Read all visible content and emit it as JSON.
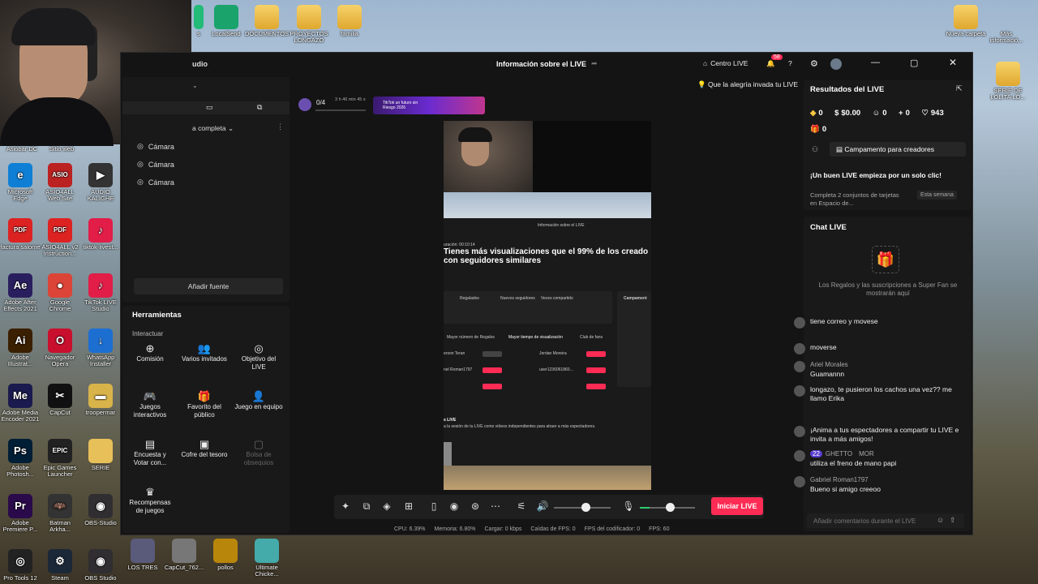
{
  "desktop_icons": {
    "top": [
      {
        "label": "s",
        "kind": "partial"
      },
      {
        "label": "LocalSend",
        "kind": "app",
        "color": "#1aa36b"
      },
      {
        "label": "DOCUMENTOS",
        "kind": "folder"
      },
      {
        "label": "PROYECTOS LONGAZO",
        "kind": "folder"
      },
      {
        "label": "familia",
        "kind": "folder"
      },
      {
        "label": "Nueva carpeta",
        "kind": "folder"
      },
      {
        "label": "Más informació...",
        "kind": "app"
      }
    ],
    "left": [
      {
        "label": "Asiobar DC",
        "kind": "partial"
      },
      {
        "label": "Sitio web",
        "kind": "partial"
      },
      {
        "label": "Microsoft Edge",
        "glyph": "e",
        "color": "#0f7fd6"
      },
      {
        "label": "ASIO4ALL Web Site",
        "glyph": "ASIO",
        "color": "#b22"
      },
      {
        "label": "AUDIO KALIGHE",
        "glyph": "▶",
        "color": "#333"
      },
      {
        "label": "factura salome",
        "glyph": "PDF",
        "color": "#d22"
      },
      {
        "label": "ASIO4ALL v2 Instruction...",
        "glyph": "PDF",
        "color": "#d22"
      },
      {
        "label": "tiktok-livest...",
        "glyph": "♪",
        "color": "#e11d48"
      },
      {
        "label": "Adobe After Effects 2021",
        "glyph": "Ae",
        "color": "#2a1f5e"
      },
      {
        "label": "Google Chrome",
        "glyph": "●",
        "color": "#db4437"
      },
      {
        "label": "TikTok LIVE Studio",
        "glyph": "♪",
        "color": "#e11d48"
      },
      {
        "label": "Adobe Illustrat...",
        "glyph": "Ai",
        "color": "#3a1f00"
      },
      {
        "label": "Navegador Opera",
        "glyph": "O",
        "color": "#c8102e"
      },
      {
        "label": "WhatsApp Installer",
        "glyph": "↓",
        "color": "#1c6fd1"
      },
      {
        "label": "Adobe Media Encoder 2021",
        "glyph": "Me",
        "color": "#1b1a4e"
      },
      {
        "label": "CapCut",
        "glyph": "✂",
        "color": "#111"
      },
      {
        "label": "troopermar",
        "glyph": "▬",
        "color": "#d8b34a"
      },
      {
        "label": "Adobe Photosh...",
        "glyph": "Ps",
        "color": "#001e36"
      },
      {
        "label": "Epic Games Launcher",
        "glyph": "EPIC",
        "color": "#222"
      },
      {
        "label": "SERIE",
        "glyph": "",
        "color": "#e8c05a"
      },
      {
        "label": "Adobe Premiere P...",
        "glyph": "Pr",
        "color": "#2a0a4a"
      },
      {
        "label": "Batman Arkha...",
        "glyph": "🦇",
        "color": "#333"
      },
      {
        "label": "OBS-Studio",
        "glyph": "◉",
        "color": "#302e31"
      },
      {
        "label": "Pro Tools 12",
        "glyph": "◎",
        "color": "#222"
      },
      {
        "label": "Steam",
        "glyph": "⚙",
        "color": "#1b2838"
      },
      {
        "label": "OBS Studio",
        "glyph": "◉",
        "color": "#302e31"
      }
    ],
    "bottom": [
      {
        "label": "LOS TRES",
        "color": "#5a5a7a"
      },
      {
        "label": "CapCut_762...",
        "color": "#777"
      },
      {
        "label": "pollos",
        "color": "#b8860b"
      },
      {
        "label": "Ultimate Chicke...",
        "color": "#4aa"
      }
    ],
    "right": [
      {
        "label": "SERIE DE LOLITA LO...",
        "kind": "folder"
      }
    ]
  },
  "window": {
    "app_title_partial": "udio",
    "center_title": "Información sobre el LIVE",
    "centro_live": "Centro LIVE",
    "notif_count": "58",
    "scene_name": "a completa",
    "sources": [
      "Cámara",
      "Cámara",
      "Cámara"
    ],
    "add_source": "Añadir fuente",
    "tools_title": "Herramientas",
    "interact_label": "Interactuar",
    "tools": [
      {
        "label": "Comisión",
        "icon": "coin-icon",
        "glyph": "⊕",
        "enabled": true
      },
      {
        "label": "Varios invitados",
        "icon": "guests-icon",
        "glyph": "👥",
        "enabled": true
      },
      {
        "label": "Objetivo del LIVE",
        "icon": "target-icon",
        "glyph": "◎",
        "enabled": true
      },
      {
        "label": "Juegos interactivos",
        "icon": "gamepad-icon",
        "glyph": "🎮",
        "enabled": true
      },
      {
        "label": "Favorito del público",
        "icon": "gift-icon",
        "glyph": "🎁",
        "enabled": true
      },
      {
        "label": "Juego en equipo",
        "icon": "team-icon",
        "glyph": "👤",
        "enabled": true
      },
      {
        "label": "Encuesta y Votar con...",
        "icon": "poll-icon",
        "glyph": "▤",
        "enabled": true
      },
      {
        "label": "Cofre del tesoro",
        "icon": "chest-icon",
        "glyph": "▣",
        "enabled": true
      },
      {
        "label": "Bolsa de obsequios",
        "icon": "bag-icon",
        "glyph": "▢",
        "enabled": false
      },
      {
        "label": "Recompensas de juegos",
        "icon": "reward-icon",
        "glyph": "♛",
        "enabled": true
      }
    ],
    "goal_progress": "0/4",
    "timer": "3 h 46 min 45 s",
    "banner_text": "TikTok un futuro sin Riesgo 2026",
    "right_hint": "Que la alegría invada tu LIVE",
    "preview": {
      "headline": "Tienes más visualizaciones que el 99% de los creado con seguidores similares",
      "mini_title": "Información sobre el LIVE",
      "tabs": [
        "Mayor número de Regalos",
        "Mayor tiempo de visualización",
        "Club de fans"
      ],
      "names": [
        "erson Teran",
        "nel Roman1797",
        "",
        "Jordan Moreira",
        "user1236061860..."
      ],
      "col_labels": [
        "Regalados",
        "Nuevos seguidores",
        "Veces compartido"
      ],
      "live_label": "s LIVE",
      "live_sub": "a la sesión de tu LIVE como vídeos independientes para atraer a más espectadores.",
      "campaign": "Campament",
      "duration": "uración: 00:10:14"
    },
    "results": {
      "title": "Resultados del LIVE",
      "diamonds": "0",
      "money": "$0.00",
      "viewers": "0",
      "new_followers": "0",
      "likes": "943",
      "gifts": "0"
    },
    "campaign_button": "Campamento para creadores",
    "promo_title": "¡Un buen LIVE empieza por un solo clic!",
    "promo_text": "Completa 2 conjuntos de tarjetas en Espacio de...",
    "promo_tag": "Esta semana",
    "chat": {
      "title": "Chat LIVE",
      "empty_text": "Los Regalos y las suscripciones a Super Fan se mostrarán aquí",
      "messages": [
        {
          "name": "",
          "text": "tiene correo y movese"
        },
        {
          "name": "",
          "text": "moverse"
        },
        {
          "name": "Ariel Morales",
          "text": "Guamannn"
        },
        {
          "name": "",
          "text": "longazo, te pusieron los cachos una vez?? me llamo Erika"
        },
        {
          "name": "",
          "text": "¡Anima a tus espectadores a compartir tu LIVE e invita a más amigos!"
        },
        {
          "name": "GHETTO",
          "badge": "22",
          "extra": "MOR",
          "text": "utiliza el freno de mano papi"
        },
        {
          "name": "Gabriel Roman1797",
          "text": "Bueno si amigo creeoo"
        }
      ],
      "input_placeholder": "Añadir comentarios durante el LIVE"
    },
    "start_live": "Iniciar LIVE",
    "status": {
      "cpu": "CPU: 6.39%",
      "memory": "Memoria: 6.80%",
      "load": "Cargar: 0 kbps",
      "fps_drops": "Caídas de FPS: 0",
      "encoder_fps": "FPS del codificador: 0",
      "fps": "FPS: 60"
    },
    "volume": 0.55,
    "mic": 0.55
  },
  "colors": {
    "accent": "#fe2c55",
    "window_bg": "#141414",
    "panel_bg": "#191919"
  }
}
